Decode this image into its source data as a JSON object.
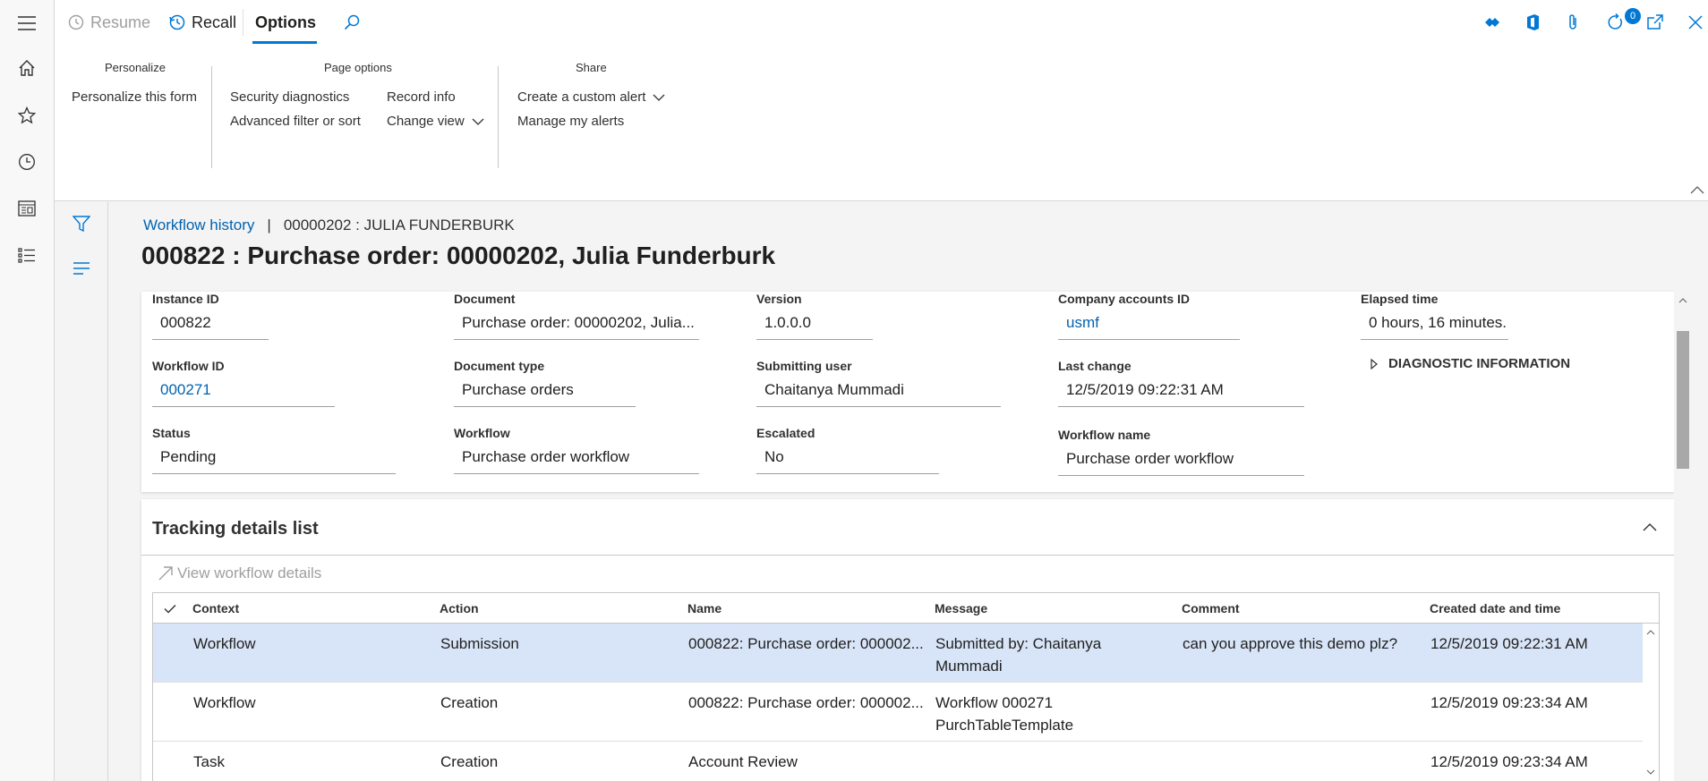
{
  "topbar": {
    "resume_label": "Resume",
    "recall_label": "Recall",
    "options_label": "Options",
    "badge_count": "0"
  },
  "ribbon": {
    "groups": {
      "personalize": {
        "title": "Personalize",
        "items": [
          "Personalize this form"
        ]
      },
      "page_options": {
        "title": "Page options",
        "items": [
          "Security diagnostics",
          "Advanced filter or sort",
          "Record info",
          "Change view"
        ]
      },
      "share": {
        "title": "Share",
        "items": [
          "Create a custom alert",
          "Manage my alerts"
        ]
      }
    }
  },
  "breadcrumb": {
    "link": "Workflow history",
    "separator": "|",
    "rest": "00000202 : JULIA FUNDERBURK"
  },
  "page_title": "000822 : Purchase order: 00000202, Julia Funderburk",
  "header_fields": {
    "instance_id": {
      "label": "Instance ID",
      "value": "000822"
    },
    "document": {
      "label": "Document",
      "value": "Purchase order: 00000202, Julia..."
    },
    "version": {
      "label": "Version",
      "value": "1.0.0.0"
    },
    "company_accounts_id": {
      "label": "Company accounts ID",
      "value": "usmf"
    },
    "elapsed_time": {
      "label": "Elapsed time",
      "value": "0 hours, 16 minutes."
    },
    "workflow_id": {
      "label": "Workflow ID",
      "value": "000271"
    },
    "document_type": {
      "label": "Document type",
      "value": "Purchase orders"
    },
    "submitting_user": {
      "label": "Submitting user",
      "value": "Chaitanya Mummadi"
    },
    "last_change": {
      "label": "Last change",
      "value": "12/5/2019 09:22:31 AM"
    },
    "status": {
      "label": "Status",
      "value": "Pending"
    },
    "workflow": {
      "label": "Workflow",
      "value": "Purchase order workflow"
    },
    "escalated": {
      "label": "Escalated",
      "value": "No"
    },
    "workflow_name": {
      "label": "Workflow name",
      "value": "Purchase order workflow"
    }
  },
  "diagnostic_label": "DIAGNOSTIC INFORMATION",
  "tracking": {
    "title": "Tracking details list",
    "view_details_label": "View workflow details",
    "columns": [
      "Context",
      "Action",
      "Name",
      "Message",
      "Comment",
      "Created date and time"
    ],
    "rows": [
      {
        "context": "Workflow",
        "action": "Submission",
        "name": "000822: Purchase order: 000002...",
        "message_line1": "Submitted by: Chaitanya",
        "message_line2": "Mummadi",
        "comment": "can you approve this demo plz?",
        "created": "12/5/2019 09:22:31 AM"
      },
      {
        "context": "Workflow",
        "action": "Creation",
        "name": "000822: Purchase order: 000002...",
        "message_line1": "Workflow 000271",
        "message_line2": "PurchTableTemplate",
        "comment": "",
        "created": "12/5/2019 09:23:34 AM"
      },
      {
        "context": "Task",
        "action": "Creation",
        "name": "Account Review",
        "message_line1": "",
        "message_line2": "",
        "comment": "",
        "created": "12/5/2019 09:23:34 AM"
      }
    ]
  },
  "colors": {
    "accent": "#0078d4",
    "link": "#0063b1",
    "selected_row": "#d8e5f8"
  }
}
